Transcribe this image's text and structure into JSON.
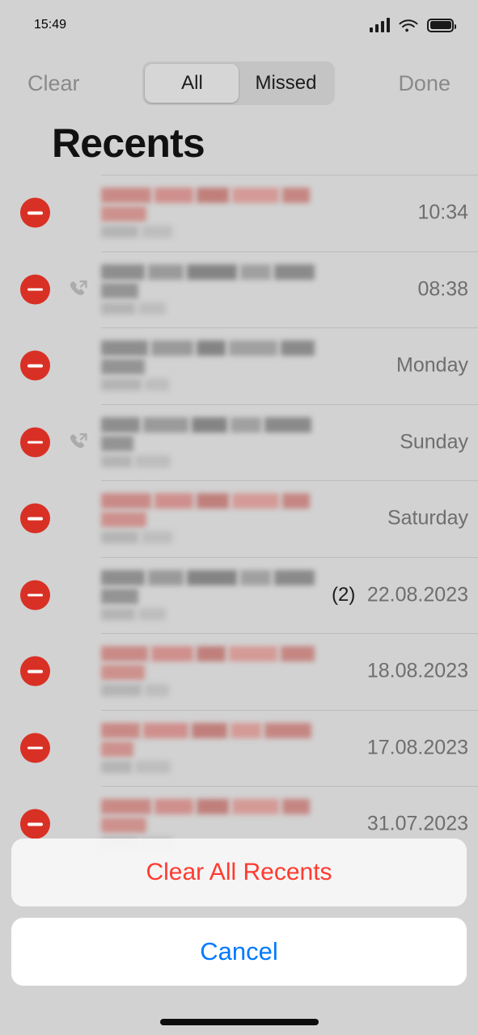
{
  "status_bar": {
    "time": "15:49",
    "icons": {
      "cellular": "cellular-signal-icon",
      "wifi": "wifi-icon",
      "battery": "battery-full-icon"
    }
  },
  "nav_bar": {
    "clear_label": "Clear",
    "done_label": "Done",
    "segmented": {
      "options": [
        "All",
        "Missed"
      ],
      "selected": "All"
    }
  },
  "page_title": "Recents",
  "edit_mode": true,
  "colors": {
    "background": "#d2d2d2",
    "destructive_red": "#ff3b30",
    "delete_badge_red": "#d93025",
    "cancel_blue": "#007aff",
    "separator": "#bcbcbc",
    "secondary_text": "#6e6e6e",
    "dimmed_nav_text": "#8a8a8a"
  },
  "call_list": [
    {
      "delete_icon": "minus-circle-icon",
      "direction_icon": null,
      "missed": true,
      "name_redacted": true,
      "subtitle_redacted": true,
      "count": null,
      "time": "10:34"
    },
    {
      "delete_icon": "minus-circle-icon",
      "direction_icon": "outgoing-call-icon",
      "missed": false,
      "name_redacted": true,
      "subtitle_redacted": true,
      "count": null,
      "time": "08:38"
    },
    {
      "delete_icon": "minus-circle-icon",
      "direction_icon": null,
      "missed": false,
      "name_redacted": true,
      "subtitle_redacted": true,
      "count": null,
      "time": "Monday"
    },
    {
      "delete_icon": "minus-circle-icon",
      "direction_icon": "outgoing-call-icon",
      "missed": false,
      "name_redacted": true,
      "subtitle_redacted": true,
      "count": null,
      "time": "Sunday"
    },
    {
      "delete_icon": "minus-circle-icon",
      "direction_icon": null,
      "missed": true,
      "name_redacted": true,
      "subtitle_redacted": true,
      "count": null,
      "time": "Saturday"
    },
    {
      "delete_icon": "minus-circle-icon",
      "direction_icon": null,
      "missed": false,
      "name_redacted": true,
      "subtitle_redacted": true,
      "count": "(2)",
      "time": "22.08.2023"
    },
    {
      "delete_icon": "minus-circle-icon",
      "direction_icon": null,
      "missed": true,
      "name_redacted": true,
      "subtitle_redacted": true,
      "count": null,
      "time": "18.08.2023"
    },
    {
      "delete_icon": "minus-circle-icon",
      "direction_icon": null,
      "missed": true,
      "name_redacted": true,
      "subtitle_redacted": true,
      "count": null,
      "time": "17.08.2023"
    },
    {
      "delete_icon": "minus-circle-icon",
      "direction_icon": null,
      "missed": true,
      "name_redacted": true,
      "subtitle_redacted": true,
      "count": null,
      "time": "31.07.2023"
    }
  ],
  "action_sheet": {
    "clear_all_label": "Clear All Recents",
    "cancel_label": "Cancel"
  },
  "home_indicator": "home-indicator"
}
